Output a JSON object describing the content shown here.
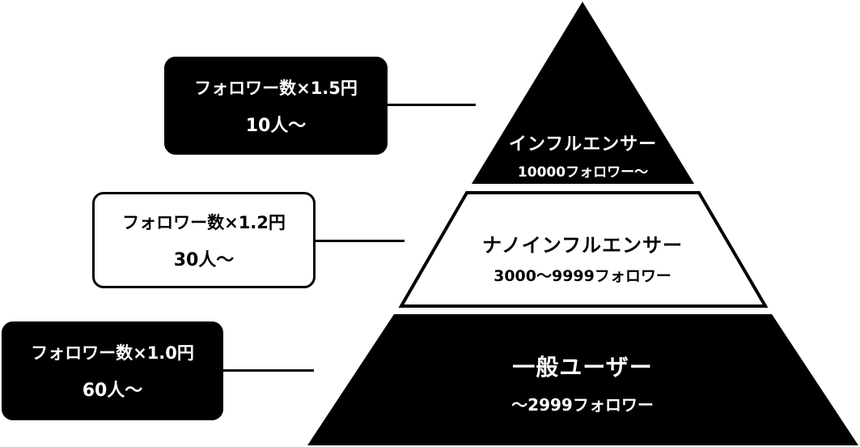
{
  "tiers": [
    {
      "title": "インフルエンサー",
      "range": "10000フォロワー〜",
      "fill": "#000000",
      "text_color": "#ffffff"
    },
    {
      "title": "ナノインフルエンサー",
      "range": "3000〜9999フォロワー",
      "fill": "#ffffff",
      "text_color": "#000000"
    },
    {
      "title": "一般ユーザー",
      "range": "〜2999フォロワー",
      "fill": "#000000",
      "text_color": "#ffffff"
    }
  ],
  "callouts": [
    {
      "rate": "フォロワー数×1.5円",
      "count": "10人〜",
      "style": "dark"
    },
    {
      "rate": "フォロワー数×1.2円",
      "count": "30人〜",
      "style": "light"
    },
    {
      "rate": "フォロワー数×1.0円",
      "count": "60人〜",
      "style": "dark"
    }
  ]
}
